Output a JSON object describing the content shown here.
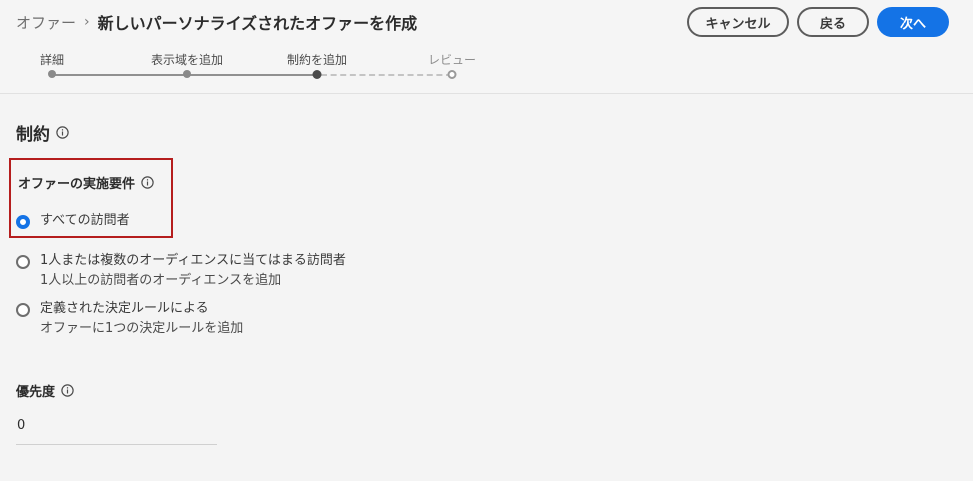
{
  "header": {
    "breadcrumb_parent": "オファー",
    "breadcrumb_separator": "›",
    "title": "新しいパーソナライズされたオファーを作成",
    "cancel_label": "キャンセル",
    "back_label": "戻る",
    "next_label": "次へ"
  },
  "steps": [
    {
      "label": "詳細",
      "state": "done"
    },
    {
      "label": "表示域を追加",
      "state": "done"
    },
    {
      "label": "制約を追加",
      "state": "current"
    },
    {
      "label": "レビュー",
      "state": "future"
    }
  ],
  "section": {
    "title": "制約"
  },
  "eligibility": {
    "label": "オファーの実施要件",
    "options": [
      {
        "label": "すべての訪問者",
        "selected": true
      },
      {
        "label": "1人または複数のオーディエンスに当てはまる訪問者",
        "sub": "1人以上の訪問者のオーディエンスを追加",
        "selected": false
      },
      {
        "label": "定義された決定ルールによる",
        "sub": "オファーに1つの決定ルールを追加",
        "selected": false
      }
    ]
  },
  "priority": {
    "label": "優先度",
    "value": "0"
  },
  "colors": {
    "primary": "#1473e6",
    "highlight": "#b51d1d"
  }
}
